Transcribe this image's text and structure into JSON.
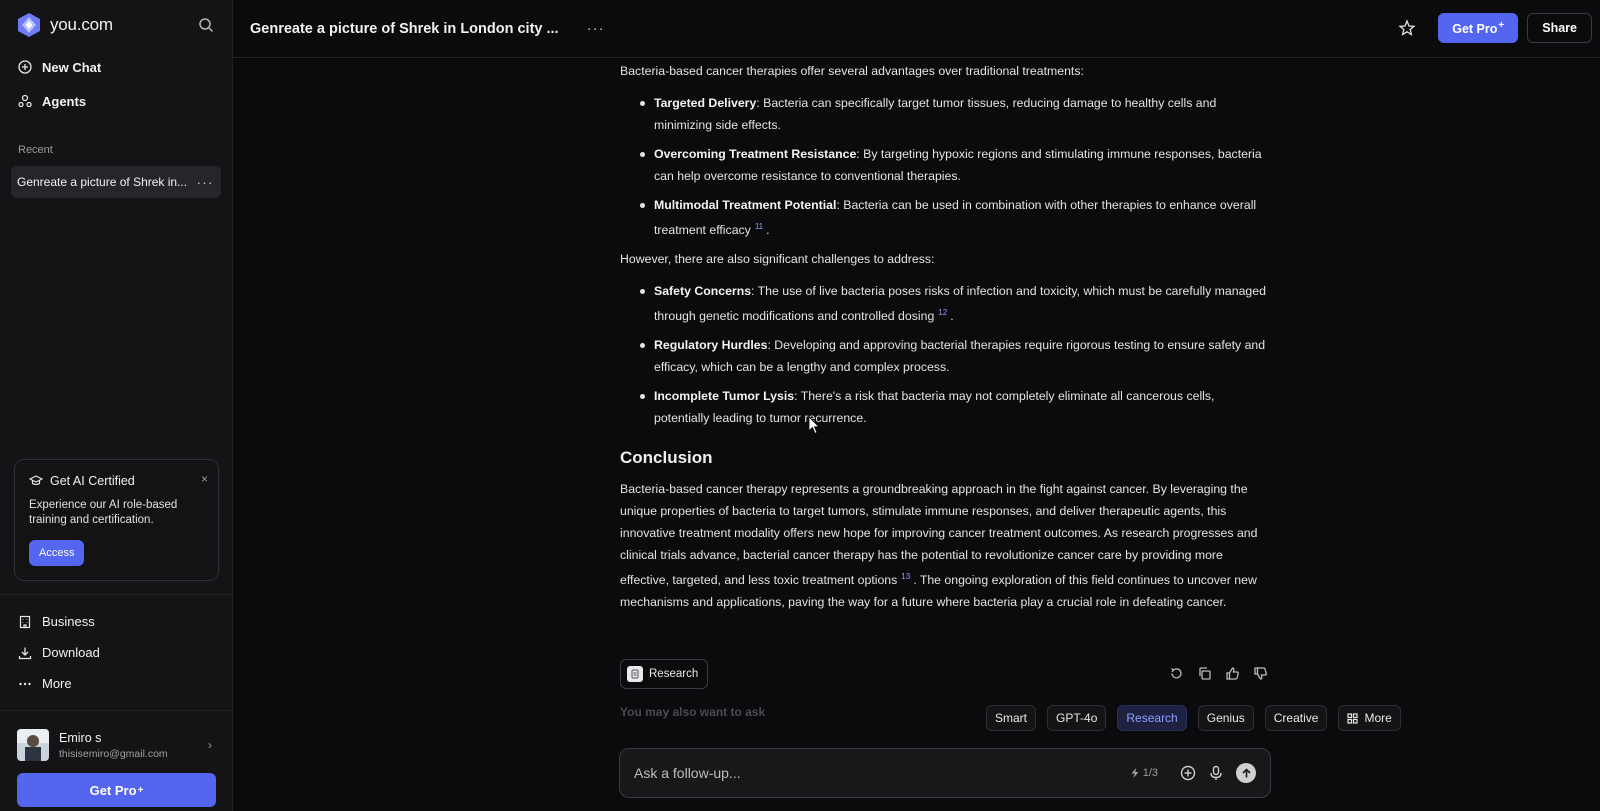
{
  "brand": {
    "name": "you.com"
  },
  "sidebar": {
    "new_chat": "New Chat",
    "agents": "Agents",
    "recent_label": "Recent",
    "recent_items": [
      {
        "label": "Genreate a picture of Shrek in..."
      }
    ],
    "cert": {
      "title": "Get AI Certified",
      "body": "Experience our AI role-based training and certification.",
      "button": "Access",
      "close": "×"
    },
    "bottom_items": [
      {
        "label": "Business"
      },
      {
        "label": "Download"
      },
      {
        "label": "More"
      }
    ],
    "user": {
      "name": "Emiro s",
      "email": "thisisemiro@gmail.com"
    },
    "pro_button": "Get Pro",
    "pro_plus": "+"
  },
  "header": {
    "title": "Genreate a picture of Shrek in London city ...",
    "pro_button": "Get Pro",
    "pro_plus": "+",
    "share_button": "Share"
  },
  "article": {
    "intro": "Bacteria-based cancer therapies offer several advantages over traditional treatments:",
    "advantages": [
      {
        "term": "Targeted Delivery",
        "text": ": Bacteria can specifically target tumor tissues, reducing damage to healthy cells and minimizing side effects.",
        "cite": ""
      },
      {
        "term": "Overcoming Treatment Resistance",
        "text": ": By targeting hypoxic regions and stimulating immune responses, bacteria can help overcome resistance to conventional therapies.",
        "cite": ""
      },
      {
        "term": "Multimodal Treatment Potential",
        "text": ": Bacteria can be used in combination with other therapies to enhance overall treatment efficacy",
        "cite": "11",
        "tail": "."
      }
    ],
    "challenges_intro": "However, there are also significant challenges to address:",
    "challenges": [
      {
        "term": "Safety Concerns",
        "text": ": The use of live bacteria poses risks of infection and toxicity, which must be carefully managed through genetic modifications and controlled dosing",
        "cite": "12",
        "tail": "."
      },
      {
        "term": "Regulatory Hurdles",
        "text": ": Developing and approving bacterial therapies require rigorous testing to ensure safety and efficacy, which can be a lengthy and complex process.",
        "cite": ""
      },
      {
        "term": "Incomplete Tumor Lysis",
        "text": ": There's a risk that bacteria may not completely eliminate all cancerous cells, potentially leading to tumor recurrence.",
        "cite": ""
      }
    ],
    "conclusion_heading": "Conclusion",
    "conclusion_part1": "Bacteria-based cancer therapy represents a groundbreaking approach in the fight against cancer. By leveraging the unique properties of bacteria to target tumors, stimulate immune responses, and deliver therapeutic agents, this innovative treatment modality offers new hope for improving cancer treatment outcomes. As research progresses and clinical trials advance, bacterial cancer therapy has the potential to revolutionize cancer care by providing more effective, targeted, and less toxic treatment options",
    "conclusion_cite": "13",
    "conclusion_part2": ". The ongoing exploration of this field continues to uncover new mechanisms and applications, paving the way for a future where bacteria play a crucial role in defeating cancer."
  },
  "answer_actions": {
    "mode_chip": "Research"
  },
  "suggest_label": "You may also want to ask",
  "modes": [
    {
      "label": "Smart",
      "active": false
    },
    {
      "label": "GPT-4o",
      "active": false
    },
    {
      "label": "Research",
      "active": true
    },
    {
      "label": "Genius",
      "active": false
    },
    {
      "label": "Creative",
      "active": false
    },
    {
      "label": "More",
      "active": false
    }
  ],
  "composer": {
    "placeholder": "Ask a follow-up...",
    "quota": "1/3"
  },
  "colors": {
    "accent": "#5465f0",
    "link": "#8fa0ff",
    "background": "#0b0b0d",
    "sidebar": "#141416"
  }
}
